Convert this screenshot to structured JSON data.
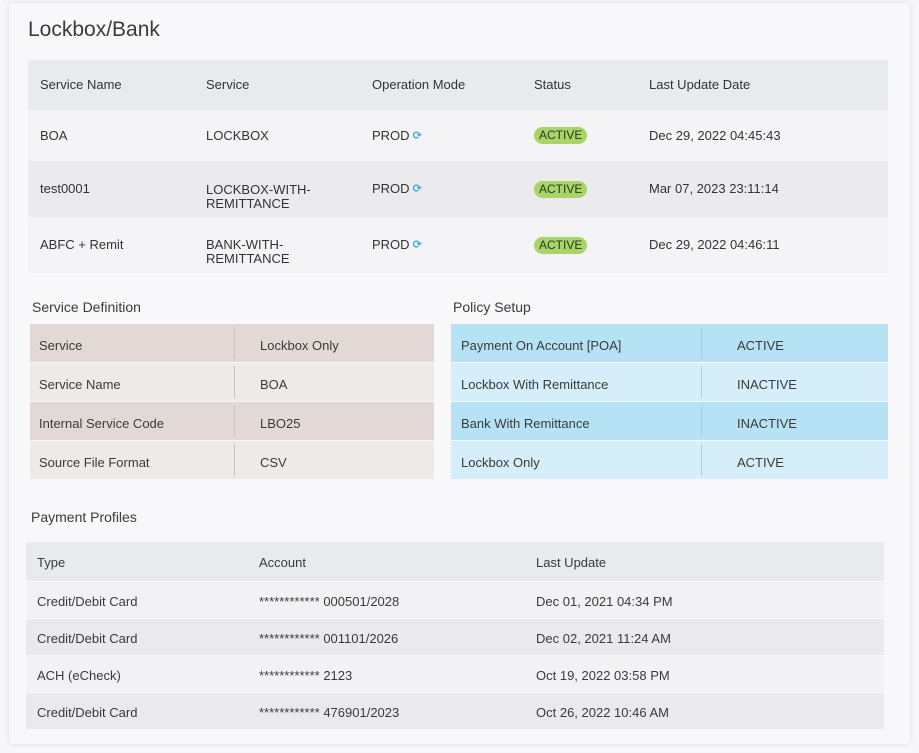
{
  "title": "Lockbox/Bank",
  "services": {
    "headers": [
      "Service Name",
      "Service",
      "Operation Mode",
      "Status",
      "Last Update Date"
    ],
    "rows": [
      {
        "name": "BOA",
        "service_line1": "LOCKBOX",
        "service_line2": "",
        "mode": "PROD",
        "status": "ACTIVE",
        "date": "Dec 29, 2022 04:45:43"
      },
      {
        "name": "test0001",
        "service_line1": "LOCKBOX-WITH-",
        "service_line2": "REMITTANCE",
        "mode": "PROD",
        "status": "ACTIVE",
        "date": "Mar 07, 2023 23:11:14"
      },
      {
        "name": "ABFC + Remit",
        "service_line1": "BANK-WITH-",
        "service_line2": "REMITTANCE",
        "mode": "PROD",
        "status": "ACTIVE",
        "date": "Dec 29, 2022 04:46:11"
      }
    ],
    "status_color": "#a8d46a",
    "refresh_icon": "refresh-icon"
  },
  "service_definition": {
    "title": "Service Definition",
    "rows": [
      {
        "key": "Service",
        "value": "Lockbox Only"
      },
      {
        "key": "Service Name",
        "value": "BOA"
      },
      {
        "key": "Internal Service Code",
        "value": "LBO25"
      },
      {
        "key": "Source File Format",
        "value": "CSV"
      }
    ]
  },
  "policy_setup": {
    "title": "Policy Setup",
    "rows": [
      {
        "key": "Payment On Account [POA]",
        "value": "ACTIVE"
      },
      {
        "key": "Lockbox With Remittance",
        "value": "INACTIVE"
      },
      {
        "key": "Bank With Remittance",
        "value": "INACTIVE"
      },
      {
        "key": "Lockbox Only",
        "value": "ACTIVE"
      }
    ]
  },
  "payment_profiles": {
    "title": "Payment Profiles",
    "headers": [
      "Type",
      "Account",
      "Last Update"
    ],
    "rows": [
      {
        "type": "Credit/Debit Card",
        "account": "************ 000501/2028",
        "updated": "Dec 01, 2021 04:34 PM"
      },
      {
        "type": "Credit/Debit Card",
        "account": "************ 001101/2026",
        "updated": "Dec 02, 2021 11:24 AM"
      },
      {
        "type": "ACH (eCheck)",
        "account": "************ 2123",
        "updated": "Oct 19, 2022 03:58 PM"
      },
      {
        "type": "Credit/Debit Card",
        "account": "************ 476901/2023",
        "updated": "Oct 26, 2022 10:46 AM"
      }
    ]
  }
}
